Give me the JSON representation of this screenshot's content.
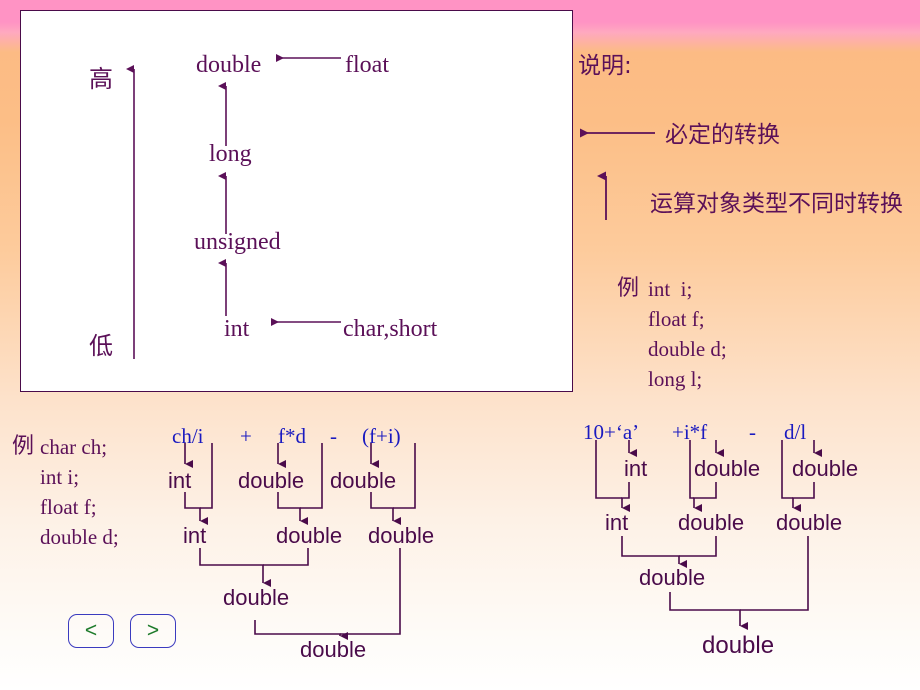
{
  "slide": {
    "panel": {
      "axis_high": "高",
      "axis_low": "低",
      "nodes": {
        "double": "double",
        "float": "float",
        "long": "long",
        "unsigned": "unsigned",
        "int": "int",
        "char_short": "char,short"
      }
    },
    "legend": {
      "title": "说明:",
      "arrow_horizontal_label": "必定的转换",
      "arrow_vertical_label": "运算对象类型不同时转换"
    },
    "example_right": {
      "marker": "例",
      "declarations": [
        "int  i;",
        "float f;",
        "double d;",
        "long l;"
      ]
    },
    "example_left": {
      "marker": "例",
      "declarations": [
        "char ch;",
        "int i;",
        "float f;",
        "double d;"
      ]
    },
    "tree_left": {
      "expression_parts": [
        "ch/i",
        "+",
        "f*d",
        "-",
        "(f+i)"
      ],
      "level1": [
        "int",
        "double",
        "double"
      ],
      "level2": [
        "int",
        "double",
        "double"
      ],
      "level3": [
        "double"
      ],
      "level4": [
        "double"
      ]
    },
    "tree_right": {
      "expression_parts": [
        "10+‘a’",
        "+i*f",
        "-",
        "d/l"
      ],
      "level1": [
        "int",
        "double",
        "double"
      ],
      "level2": [
        "int",
        "double",
        "double"
      ],
      "level3": [
        "double"
      ],
      "level4": [
        "double"
      ]
    },
    "nav": {
      "prev_label": "<",
      "next_label": ">"
    },
    "colors": {
      "text_purple": "#5b1058",
      "node_purple": "#4a0b4a",
      "expr_blue": "#1a1ac0",
      "nav_border": "#3b3bbf",
      "nav_glyph": "#1d7a2a",
      "panel_bg": "#ffffff",
      "bg_top": "#ff93c4",
      "bg_mid": "#fcbb84",
      "bg_bottom": "#ffffff"
    }
  }
}
